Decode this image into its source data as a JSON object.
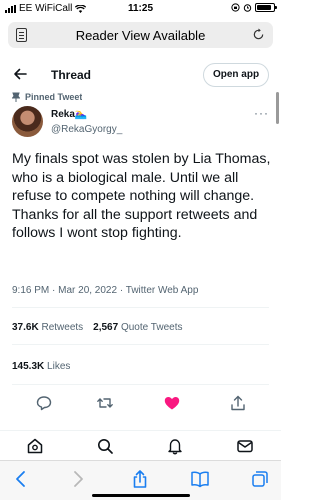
{
  "status_bar": {
    "carrier": "EE WiFiCall",
    "time": "11:25",
    "battery_level": 0.9
  },
  "reader_bar": {
    "title": "Reader View Available"
  },
  "header": {
    "title": "Thread",
    "open_app_label": "Open app"
  },
  "tweet": {
    "pinned_label": "Pinned Tweet",
    "display_name": "Reka🏊‍♀️",
    "handle": "@RekaGyorgy_",
    "more_label": "···",
    "text": "My finals spot was stolen by Lia Thomas, who is a biological male. Until we all refuse to compete nothing will change. Thanks for all the support retweets and follows I wont stop fighting.",
    "timestamp": "9:16 PM · Mar 20, 2022 · Twitter Web App",
    "retweets_count": "37.6K",
    "retweets_label": "Retweets",
    "quotes_count": "2,567",
    "quotes_label": "Quote Tweets",
    "likes_count": "145.3K",
    "likes_label": "Likes"
  },
  "actions": [
    "reply-icon",
    "retweet-icon",
    "like-icon",
    "share-icon"
  ],
  "bottom_nav": [
    "home-icon",
    "search-icon",
    "notifications-icon",
    "messages-icon"
  ],
  "safari_toolbar": [
    "back-icon",
    "forward-icon",
    "share-icon",
    "bookmarks-icon",
    "tabs-icon"
  ],
  "colors": {
    "like_active": "#f91880",
    "text_primary": "#0f1419",
    "text_secondary": "#536471",
    "safari_blue": "#1a7ef0"
  }
}
